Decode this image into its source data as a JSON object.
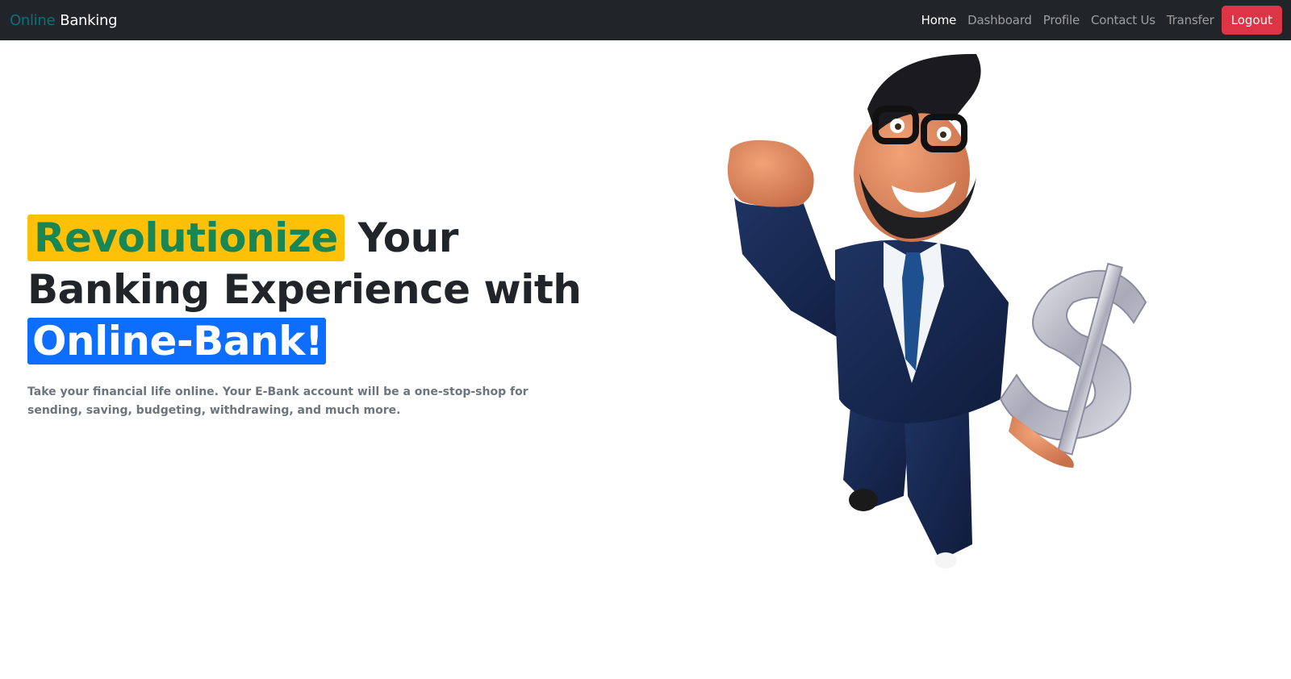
{
  "navbar": {
    "brand_part1": "Online",
    "brand_part2": "Banking",
    "links": [
      {
        "label": "Home"
      },
      {
        "label": "Dashboard"
      },
      {
        "label": "Profile"
      },
      {
        "label": "Contact Us"
      },
      {
        "label": "Transfer"
      }
    ],
    "logout_label": "Logout"
  },
  "hero": {
    "highlight1": "Revolutionize",
    "text1": " Your Banking Experience with ",
    "highlight2": "Online-Bank!",
    "lead": "Take your financial life online. Your E-Bank account will be a one-stop-shop for sending, saving, budgeting, withdrawing, and much more.",
    "image_subject": "3d-businessman-holding-dollar-sign"
  },
  "colors": {
    "navbar_bg": "#212529",
    "logout_bg": "#dc3545",
    "highlight_yellow": "#ffc107",
    "highlight_green_text": "#198754",
    "highlight_blue": "#0d6efd",
    "lead_text": "#6c757d"
  }
}
